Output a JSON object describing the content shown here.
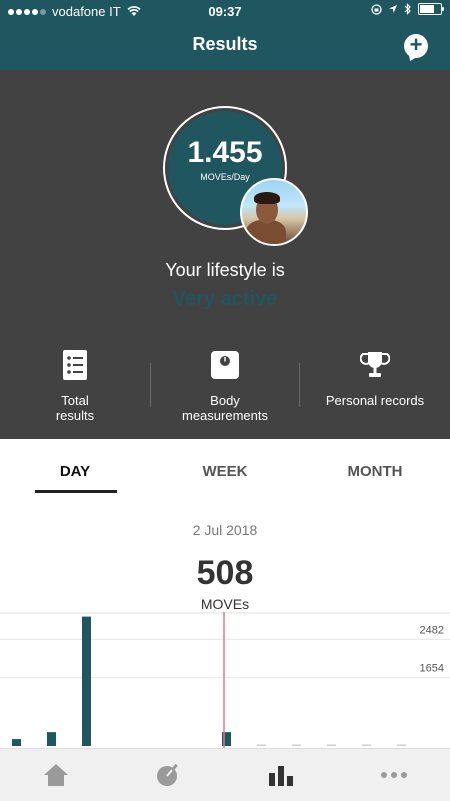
{
  "status_bar": {
    "carrier": "vodafone IT",
    "time": "09:37",
    "battery_level": 0.7
  },
  "header": {
    "title": "Results",
    "add_icon": "add-comment-icon"
  },
  "hero": {
    "score_value": "1.455",
    "score_unit": "MOVEs/Day",
    "lifestyle_label": "Your lifestyle is",
    "lifestyle_value": "Very active"
  },
  "actions": [
    {
      "label_line1": "Total",
      "label_line2": "results",
      "icon": "list-icon"
    },
    {
      "label_line1": "Body",
      "label_line2": "measurements",
      "icon": "scale-icon"
    },
    {
      "label_line1": "Personal records",
      "label_line2": "",
      "icon": "trophy-icon"
    }
  ],
  "tabs": [
    {
      "label": "DAY",
      "active": true
    },
    {
      "label": "WEEK",
      "active": false
    },
    {
      "label": "MONTH",
      "active": false
    }
  ],
  "day_summary": {
    "date": "2 Jul 2018",
    "moves_value": "508",
    "moves_unit": "MOVEs"
  },
  "chart_data": {
    "type": "bar",
    "y_ticks": [
      2482,
      1654
    ],
    "values": [
      150,
      300,
      2800,
      0,
      0,
      0,
      300,
      10,
      10,
      10,
      10,
      5
    ],
    "current_index": 10,
    "bar_color": "#1f5660",
    "marker_color": "#e07a8a"
  },
  "bottom_nav": [
    {
      "icon": "home-icon"
    },
    {
      "icon": "timer-icon"
    },
    {
      "icon": "results-chart-icon",
      "active": true
    },
    {
      "icon": "more-icon"
    }
  ],
  "colors": {
    "brand": "#1f5660",
    "hero_bg": "#424242"
  }
}
